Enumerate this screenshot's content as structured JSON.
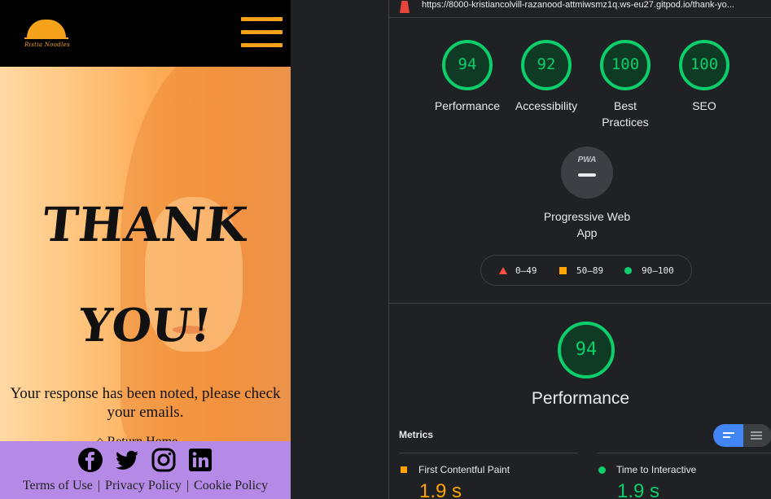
{
  "site": {
    "logo_text": "Ristia Noodles",
    "hero_line1": "THANK",
    "hero_line2": "YOU!",
    "message": "Your response has been noted, please check your emails.",
    "return_link": "Return Home",
    "social_icons": [
      "facebook-icon",
      "twitter-icon",
      "instagram-icon",
      "linkedin-icon"
    ],
    "footer_links": [
      "Terms of Use",
      "Privacy Policy",
      "Cookie Policy"
    ],
    "footer_separator": "|",
    "colors": {
      "header_bg": "#000000",
      "accent": "#f6a21b",
      "footer_bg": "#b48ae6"
    }
  },
  "lighthouse": {
    "url": "https://8000-kristiancolvill-razanood-attmiwsmz1q.ws-eu27.gitpod.io/thank-yo...",
    "scores": [
      {
        "label": "Performance",
        "value": 94
      },
      {
        "label": "Accessibility",
        "value": 92
      },
      {
        "label": "Best Practices",
        "value": 100
      },
      {
        "label": "SEO",
        "value": 100
      }
    ],
    "pwa": {
      "badge": "PWA",
      "label": "Progressive Web App"
    },
    "legend": [
      {
        "range": "0–49",
        "shape": "triangle",
        "color": "#ff4e42"
      },
      {
        "range": "50–89",
        "shape": "square",
        "color": "#ffa400"
      },
      {
        "range": "90–100",
        "shape": "circle",
        "color": "#0cce6b"
      }
    ],
    "main_score": {
      "value": 94,
      "title": "Performance"
    },
    "metrics_title": "Metrics",
    "metrics": [
      {
        "name": "First Contentful Paint",
        "value": "1.9 s",
        "color": "#ffa400"
      },
      {
        "name": "Time to Interactive",
        "value": "1.9 s",
        "color": "#0cce6b"
      }
    ],
    "colors": {
      "pass": "#0cce6b",
      "average": "#ffa400",
      "fail": "#ff4e42"
    }
  }
}
